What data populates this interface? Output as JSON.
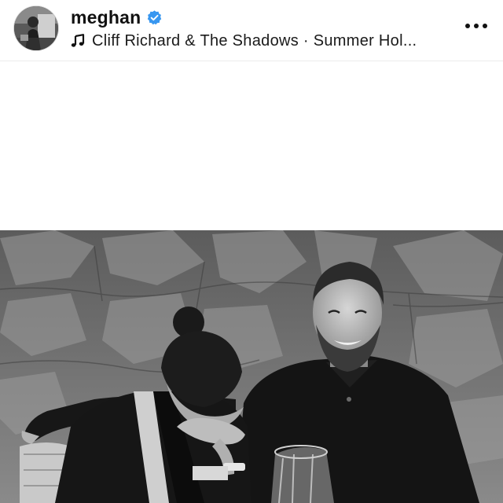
{
  "post": {
    "username": "meghan",
    "verified": true,
    "music": "Cliff Richard & The Shadows · Summer Hol...",
    "icons": {
      "avatar": "profile-avatar",
      "verified": "verified-badge-icon",
      "music": "music-note-icon",
      "more": "more-options-icon"
    },
    "colors": {
      "verified_blue": "#3897f0",
      "text": "#111111",
      "background": "#ffffff"
    }
  }
}
